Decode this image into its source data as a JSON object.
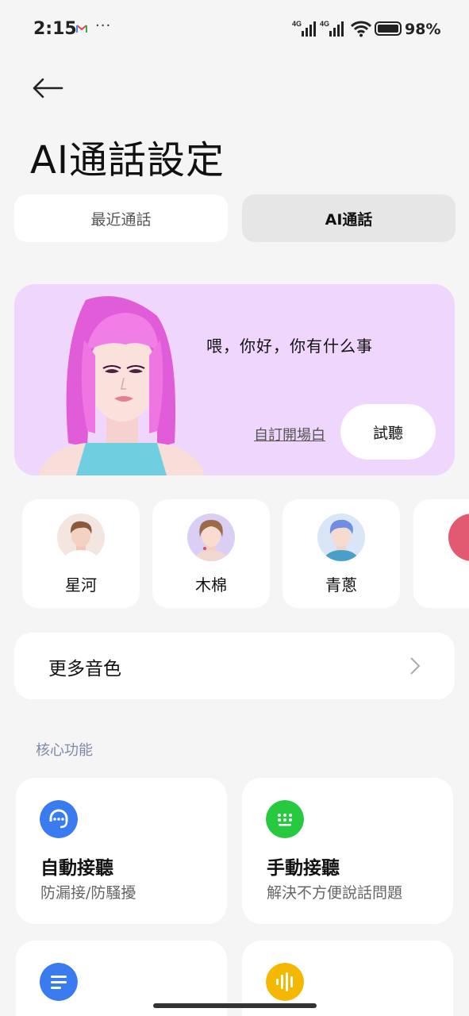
{
  "status_bar": {
    "time": "2:15",
    "more": "···",
    "net1": "4G",
    "net2": "4G",
    "battery": "98%"
  },
  "page": {
    "title": "AI通話設定"
  },
  "tabs": [
    {
      "label": "最近通話",
      "selected": false
    },
    {
      "label": "AI通話",
      "selected": true
    }
  ],
  "hero": {
    "greeting": "喂，你好，你有什么事",
    "custom_opening": "自訂開場白",
    "listen": "試聽",
    "bg": "#efd6fc"
  },
  "voices": [
    {
      "name": "星河"
    },
    {
      "name": "木棉"
    },
    {
      "name": "青蔥"
    }
  ],
  "more_voices": {
    "label": "更多音色"
  },
  "core": {
    "section_label": "核心功能",
    "features": [
      {
        "title": "自動接聽",
        "subtitle": "防漏接/防騷擾",
        "icon": "headset-icon",
        "color": "#3a7bf0"
      },
      {
        "title": "手動接聽",
        "subtitle": "解決不方便說話問題",
        "icon": "keypad-icon",
        "color": "#27c93f"
      },
      {
        "title": "",
        "subtitle": "",
        "icon": "message-icon",
        "color": "#3a7bf0"
      },
      {
        "title": "",
        "subtitle": "",
        "icon": "voice-wave-icon",
        "color": "#f5b800"
      }
    ]
  }
}
